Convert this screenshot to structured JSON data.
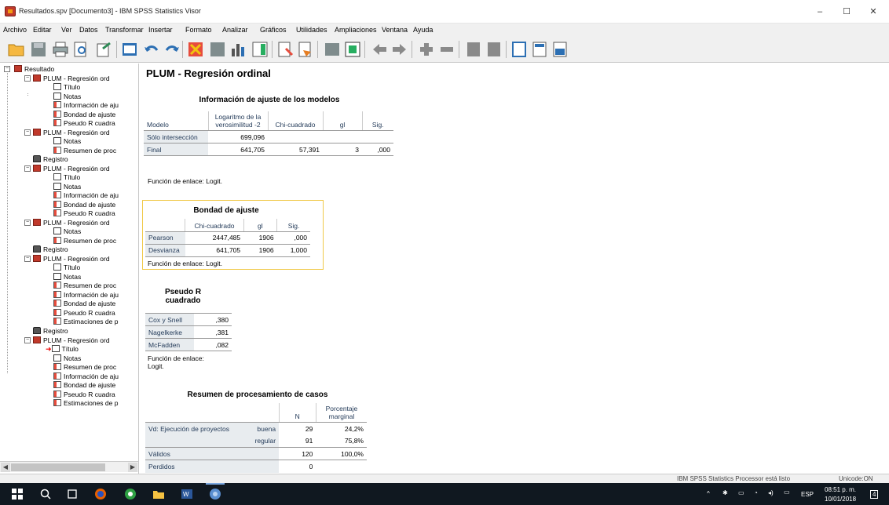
{
  "window": {
    "title": "Resultados.spv [Documento3] - IBM SPSS Statistics Visor",
    "minimize": "–",
    "maximize": "☐",
    "close": "✕"
  },
  "menu": [
    "Archivo",
    "Editar",
    "Ver",
    "Datos",
    "Transformar",
    "Insertar",
    "Formato",
    "Analizar",
    "Gráficos",
    "Utilidades",
    "Ampliaciones",
    "Ventana",
    "Ayuda"
  ],
  "outline": {
    "root": "Resultado",
    "plum": "PLUM - Regresión ord",
    "titulo": "Título",
    "notas": "Notas",
    "info": "Información de aju",
    "bondad": "Bondad de ajuste",
    "pseudo": "Pseudo R cuadra",
    "resumen": "Resumen de proc",
    "registro": "Registro",
    "estim": "Estimaciones de p"
  },
  "content": {
    "section_title": "PLUM - Regresión ordinal",
    "model_fit": {
      "title": "Información de ajuste de los modelos",
      "headers": [
        "Modelo",
        "Logaritmo de la verosimilitud -2",
        "Chi-cuadrado",
        "gl",
        "Sig."
      ],
      "rows": [
        [
          "Sólo intersección",
          "699,096",
          "",
          "",
          ""
        ],
        [
          "Final",
          "641,705",
          "57,391",
          "3",
          ",000"
        ]
      ],
      "footnote": "Función de enlace: Logit."
    },
    "goodness": {
      "title": "Bondad de ajuste",
      "headers": [
        "",
        "Chi-cuadrado",
        "gl",
        "Sig."
      ],
      "rows": [
        [
          "Pearson",
          "2447,485",
          "1906",
          ",000"
        ],
        [
          "Desvianza",
          "641,705",
          "1906",
          "1,000"
        ]
      ],
      "footnote": "Función de enlace: Logit."
    },
    "pseudo_r": {
      "title": "Pseudo R cuadrado",
      "rows": [
        [
          "Cox y Snell",
          ",380"
        ],
        [
          "Nagelkerke",
          ",381"
        ],
        [
          "McFadden",
          ",082"
        ]
      ],
      "footnote": "Función de enlace: Logit."
    },
    "case_summary": {
      "title": "Resumen de procesamiento de casos",
      "headers": [
        "",
        "",
        "N",
        "Porcentaje marginal"
      ],
      "rows": [
        [
          "Vd: Ejecución de proyectos",
          "buena",
          "29",
          "24,2%"
        ],
        [
          "",
          "regular",
          "91",
          "75,8%"
        ],
        [
          "Válidos",
          "",
          "120",
          "100,0%"
        ],
        [
          "Perdidos",
          "",
          "0",
          ""
        ]
      ]
    }
  },
  "statusbar": {
    "processor": "IBM SPSS Statistics Processor está listo",
    "unicode": "Unicode:ON"
  },
  "taskbar": {
    "lang": "ESP",
    "time": "08:51 p. m.",
    "date": "10/01/2018",
    "notifications": "4"
  }
}
